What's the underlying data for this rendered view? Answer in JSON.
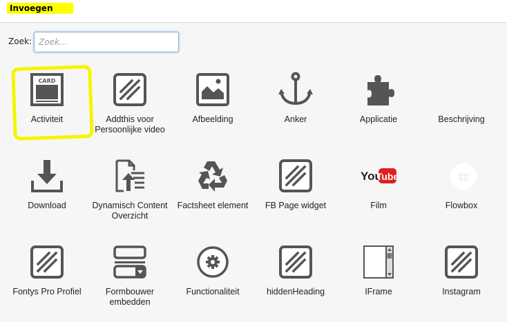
{
  "header": {
    "title": "Invoegen"
  },
  "search": {
    "label": "Zoek:",
    "placeholder": "Zoek..."
  },
  "card_icon_text": "CARD",
  "youtube_text": {
    "you": "You",
    "tube": "Tube"
  },
  "items": [
    {
      "label": "Activiteit",
      "icon": "card-icon"
    },
    {
      "label": "Addthis voor Persoonlijke video",
      "icon": "hatched-square-icon"
    },
    {
      "label": "Afbeelding",
      "icon": "image-icon"
    },
    {
      "label": "Anker",
      "icon": "anchor-icon"
    },
    {
      "label": "Applicatie",
      "icon": "puzzle-icon"
    },
    {
      "label": "Beschrijving",
      "icon": ""
    },
    {
      "label": "Download",
      "icon": "download-icon"
    },
    {
      "label": "Dynamisch Content Overzicht",
      "icon": "document-list-icon"
    },
    {
      "label": "Factsheet element",
      "icon": "recycle-icon"
    },
    {
      "label": "FB Page widget",
      "icon": "hatched-square-icon"
    },
    {
      "label": "Film",
      "icon": "youtube-icon"
    },
    {
      "label": "Flowbox",
      "icon": "flowbox-icon"
    },
    {
      "label": "Fontys Pro Profiel",
      "icon": "hatched-square-icon"
    },
    {
      "label": "Formbouwer embedden",
      "icon": "form-icon"
    },
    {
      "label": "Functionaliteit",
      "icon": "gear-icon"
    },
    {
      "label": "hiddenHeading",
      "icon": "hatched-square-icon"
    },
    {
      "label": "IFrame",
      "icon": "iframe-icon"
    },
    {
      "label": "Instagram",
      "icon": "hatched-square-icon"
    }
  ]
}
